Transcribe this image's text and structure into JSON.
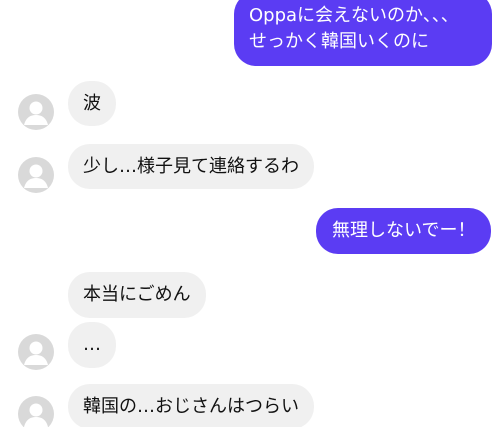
{
  "messages": [
    {
      "direction": "outgoing",
      "lines": [
        "Oppaに会えないのか、、、",
        "せっかく韓国いくのに"
      ]
    },
    {
      "direction": "incoming",
      "text": "波",
      "avatar": "default-avatar-icon"
    },
    {
      "direction": "incoming",
      "text": "少し…様子見て連絡するわ",
      "avatar": "default-avatar-icon"
    },
    {
      "direction": "outgoing",
      "text": "無理しないでー！"
    },
    {
      "direction": "incoming",
      "text": "本当にごめん"
    },
    {
      "direction": "incoming",
      "text": "…",
      "avatar": "default-avatar-icon"
    },
    {
      "direction": "incoming",
      "text": "韓国の…おじさんはつらい",
      "avatar": "default-avatar-icon"
    }
  ],
  "colors": {
    "outgoing_bubble": "#5b3cf3",
    "incoming_bubble": "#f0f0f0",
    "avatar_bg": "#d9d9d9",
    "avatar_fg": "#ffffff"
  }
}
